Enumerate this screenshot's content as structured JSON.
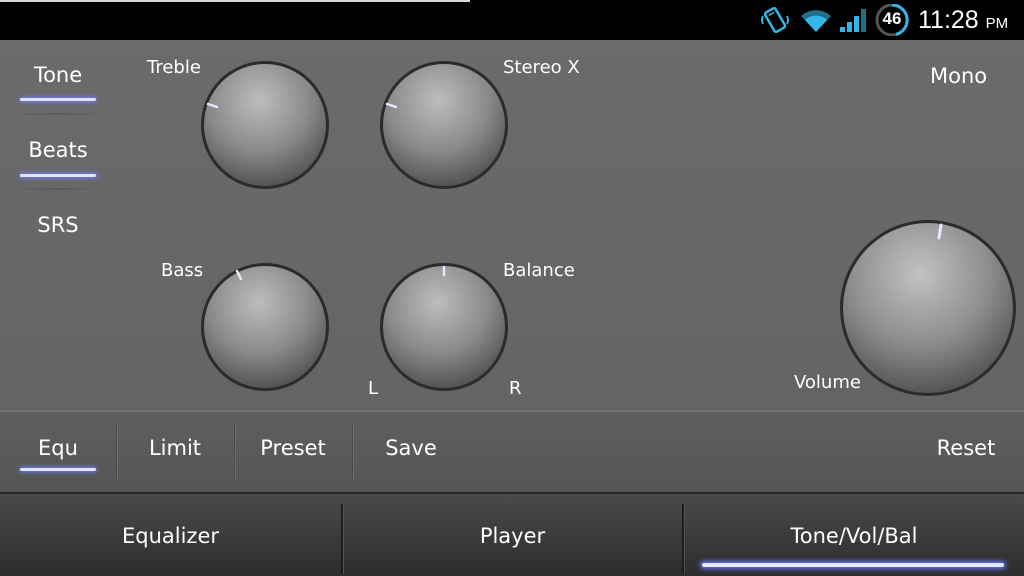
{
  "status_bar": {
    "battery_level": "46",
    "time": "11:28",
    "ampm": "PM",
    "icons": [
      "phone-vibrate-icon",
      "wifi-icon",
      "signal-icon",
      "battery-icon"
    ],
    "accent": "#33b5e5"
  },
  "side_tabs": [
    {
      "label": "Tone",
      "selected": true
    },
    {
      "label": "Beats",
      "selected": true
    },
    {
      "label": "SRS",
      "selected": false
    }
  ],
  "knobs": {
    "treble": {
      "label": "Treble"
    },
    "stereo_x": {
      "label": "Stereo X"
    },
    "bass": {
      "label": "Bass"
    },
    "balance": {
      "label": "Balance",
      "left_label": "L",
      "right_label": "R"
    },
    "volume": {
      "label": "Volume"
    }
  },
  "mono_label": "Mono",
  "toolbar": {
    "equ": "Equ",
    "limit": "Limit",
    "preset": "Preset",
    "save": "Save",
    "reset": "Reset"
  },
  "tabs": {
    "equalizer": "Equalizer",
    "player": "Player",
    "tone_vol_bal": "Tone/Vol/Bal",
    "selected": "Tone/Vol/Bal"
  },
  "colors": {
    "indicator": "#6f7cff",
    "panel": "#666666"
  }
}
